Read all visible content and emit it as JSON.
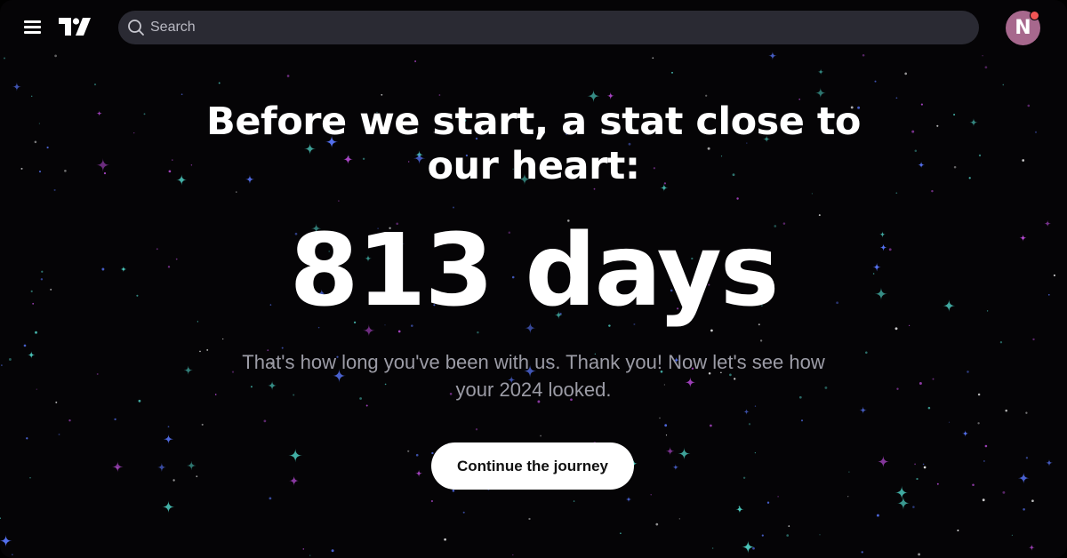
{
  "header": {
    "menu_icon": "hamburger-menu-icon",
    "logo_icon": "tradingview-logo-icon",
    "search": {
      "placeholder": "Search",
      "icon": "search-icon"
    },
    "avatar": {
      "initial": "N",
      "color": "#a7688d",
      "notification_color": "#f25555"
    }
  },
  "main": {
    "headline": "Before we start, a stat close to our heart:",
    "stat": "813 days",
    "subtext": "That's how long you've been with us. Thank you! Now let's see how your 2024 looked.",
    "cta_label": "Continue the journey"
  },
  "theme": {
    "background": "#050406",
    "star_colors": [
      "#4fd1c5",
      "#c04ee0",
      "#5a78ff",
      "#ffffff"
    ]
  }
}
